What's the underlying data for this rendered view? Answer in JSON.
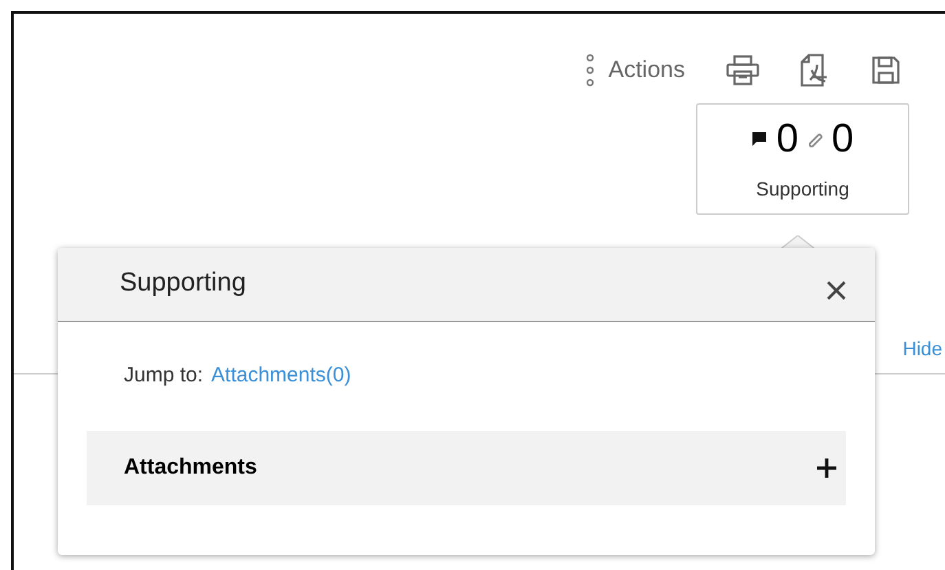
{
  "toolbar": {
    "actions_label": "Actions"
  },
  "supporting_card": {
    "comments_count": "0",
    "attachments_count": "0",
    "label": "Supporting"
  },
  "hide_link": "Hide",
  "popover": {
    "title": "Supporting",
    "jump_to_label": "Jump to:",
    "jump_to_link": "Attachments(0)",
    "sections": [
      {
        "title": "Attachments"
      }
    ]
  }
}
